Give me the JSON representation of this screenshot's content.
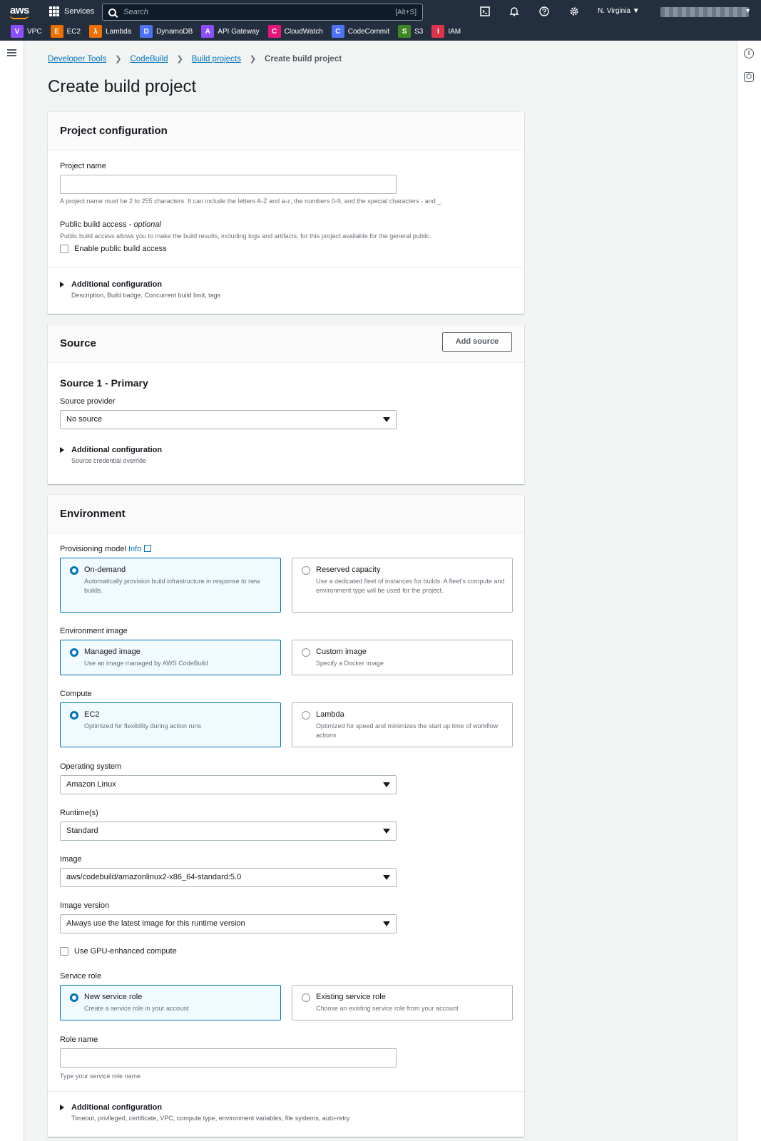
{
  "topbar": {
    "logo": "aws",
    "services": "Services",
    "search_placeholder": "Search",
    "search_shortcut": "[Alt+S]",
    "region": "N. Virginia ▼",
    "icons": [
      "cloudshell-icon",
      "bell-icon",
      "help-icon",
      "gear-icon"
    ],
    "favorites": [
      {
        "label": "VPC",
        "color": "#8c4fff",
        "glyph": "V"
      },
      {
        "label": "EC2",
        "color": "#ed7100",
        "glyph": "E"
      },
      {
        "label": "Lambda",
        "color": "#ed7100",
        "glyph": "λ"
      },
      {
        "label": "DynamoDB",
        "color": "#4d72f3",
        "glyph": "D"
      },
      {
        "label": "API Gateway",
        "color": "#8c4fff",
        "glyph": "A"
      },
      {
        "label": "CloudWatch",
        "color": "#e7157b",
        "glyph": "C"
      },
      {
        "label": "CodeCommit",
        "color": "#4d72f3",
        "glyph": "C"
      },
      {
        "label": "S3",
        "color": "#3f8624",
        "glyph": "S"
      },
      {
        "label": "IAM",
        "color": "#dd344c",
        "glyph": "I"
      }
    ]
  },
  "breadcrumbs": [
    "Developer Tools",
    "CodeBuild",
    "Build projects",
    "Create build project"
  ],
  "page_title": "Create build project",
  "project": {
    "heading": "Project configuration",
    "name_label": "Project name",
    "name_value": "",
    "name_hint": "A project name must be 2 to 255 characters. It can include the letters A-Z and a-z, the numbers 0-9, and the special characters - and _.",
    "public_label": "Public build access",
    "public_optional": "- optional",
    "public_desc": "Public build access allows you to make the build results, including logs and artifacts, for this project available for the general public.",
    "public_checkbox": "Enable public build access",
    "addl_title": "Additional configuration",
    "addl_desc": "Description, Build badge, Concurrent build limit, tags"
  },
  "source": {
    "heading": "Source",
    "add_button": "Add source",
    "sub_heading": "Source 1 - Primary",
    "provider_label": "Source provider",
    "provider_value": "No source",
    "addl_title": "Additional configuration",
    "addl_desc": "Source credential override"
  },
  "environment": {
    "heading": "Environment",
    "prov_label": "Provisioning model",
    "info": "Info",
    "prov_options": [
      {
        "title": "On-demand",
        "desc": "Automatically provision build infrastructure in response to new builds.",
        "selected": true
      },
      {
        "title": "Reserved capacity",
        "desc": "Use a dedicated fleet of instances for builds. A fleet's compute and environment type will be used for the project.",
        "selected": false
      }
    ],
    "image_label": "Environment image",
    "image_options": [
      {
        "title": "Managed image",
        "desc": "Use an image managed by AWS CodeBuild",
        "selected": true
      },
      {
        "title": "Custom image",
        "desc": "Specify a Docker image",
        "selected": false
      }
    ],
    "compute_label": "Compute",
    "compute_options": [
      {
        "title": "EC2",
        "desc": "Optimized for flexibility during action runs",
        "selected": true
      },
      {
        "title": "Lambda",
        "desc": "Optimized for speed and minimizes the start up time of workflow actions",
        "selected": false
      }
    ],
    "os_label": "Operating system",
    "os_value": "Amazon Linux",
    "runtime_label": "Runtime(s)",
    "runtime_value": "Standard",
    "img_label": "Image",
    "img_value": "aws/codebuild/amazonlinux2-x86_64-standard:5.0",
    "imgver_label": "Image version",
    "imgver_value": "Always use the latest image for this runtime version",
    "gpu_checkbox": "Use GPU-enhanced compute",
    "role_label": "Service role",
    "role_options": [
      {
        "title": "New service role",
        "desc": "Create a service role in your account",
        "selected": true
      },
      {
        "title": "Existing service role",
        "desc": "Choose an existing service role from your account",
        "selected": false
      }
    ],
    "role_name_label": "Role name",
    "role_name_value": "",
    "role_name_hint": "Type your service role name",
    "addl_title": "Additional configuration",
    "addl_desc": "Timeout, privileged, certificate, VPC, compute type, environment variables, file systems, auto-retry"
  }
}
